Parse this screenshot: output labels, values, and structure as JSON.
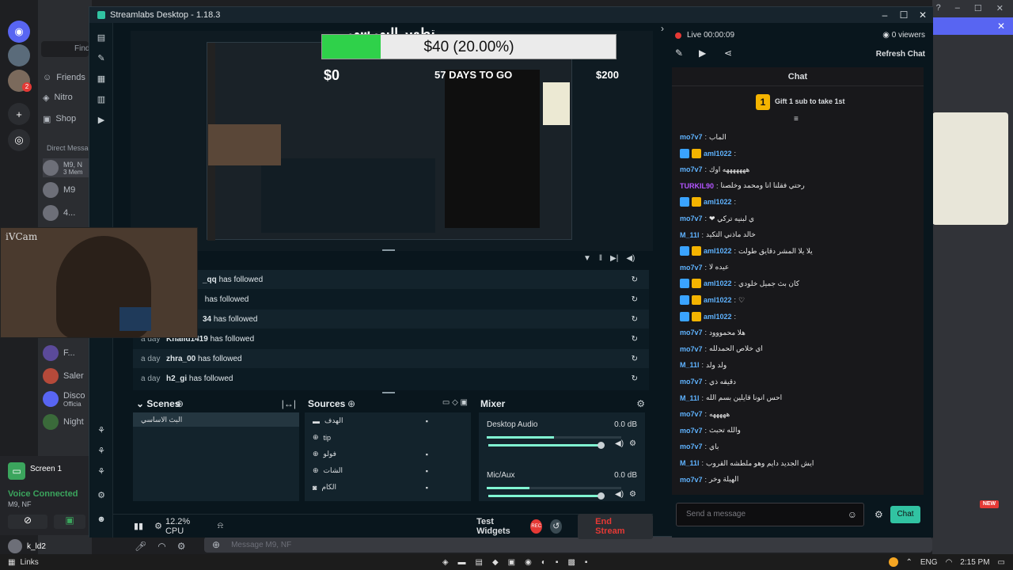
{
  "discord": {
    "find_label": "Find",
    "nav": [
      {
        "label": "Friends"
      },
      {
        "label": "Nitro"
      },
      {
        "label": "Shop"
      }
    ],
    "direct_messages_header": "Direct Messages",
    "dms": [
      {
        "name": "M9, N",
        "sub": "3 Mem"
      },
      {
        "name": "M9",
        "sub": ""
      },
      {
        "name": "4...",
        "sub": ""
      },
      {
        "name": "F...",
        "sub": ""
      },
      {
        "name": "Saler",
        "sub": ""
      },
      {
        "name": "Disco",
        "sub": "Officia"
      },
      {
        "name": "Night",
        "sub": ""
      }
    ],
    "screen_label": "Screen 1",
    "voice_connected": "Voice Connected",
    "voice_channel": "M9, NF",
    "username": "k_ld2",
    "message_placeholder": "Message M9, NF",
    "new_badge": "NEW",
    "mention_count": "2"
  },
  "webcam": {
    "label": "iVCam"
  },
  "streamlabs": {
    "title": "Streamlabs Desktop - 1.18.3",
    "overlay_title": "تطوير البي سي",
    "goal": {
      "text": "$40 (20.00%)",
      "progress": 0.2,
      "start": "$0",
      "days": "57 DAYS TO GO",
      "end": "$200"
    },
    "events": [
      {
        "time": "",
        "name": "_qq",
        "action": "has followed"
      },
      {
        "time": "",
        "name": "",
        "action": "has followed"
      },
      {
        "time": "",
        "name": "34",
        "action": "has followed"
      },
      {
        "time": "a day",
        "name": "Khalid1419",
        "action": "has followed"
      },
      {
        "time": "a day",
        "name": "zhra_00",
        "action": "has followed"
      },
      {
        "time": "a day",
        "name": "h2_gi",
        "action": "has followed"
      }
    ],
    "scenes": {
      "title": "Scenes",
      "items": [
        "البث الاساسي"
      ]
    },
    "sources": {
      "title": "Sources",
      "items": [
        "الهدف",
        "tip",
        "فولو",
        "الشات",
        "الكام"
      ]
    },
    "mixer": {
      "title": "Mixer",
      "channels": [
        {
          "name": "Desktop Audio",
          "db": "0.0 dB",
          "level": 0.95
        },
        {
          "name": "Mic/Aux",
          "db": "0.0 dB",
          "level": 0.95
        }
      ]
    },
    "footer": {
      "cpu": "12.2% CPU",
      "test_widgets": "Test Widgets",
      "end_stream": "End Stream"
    },
    "chat": {
      "live": "Live 00:00:09",
      "viewers": "0 viewers",
      "refresh": "Refresh Chat",
      "header": "Chat",
      "gift_rank": "1",
      "gift": "Gift 1 sub to take 1st",
      "placeholder": "Send a message",
      "send": "Chat",
      "messages": [
        {
          "user": "mo7v7",
          "msg": "الماب",
          "color": "#5fb3ff",
          "badges": false
        },
        {
          "user": "aml1022",
          "msg": "",
          "color": "#5fb3ff",
          "badges": true
        },
        {
          "user": "mo7v7",
          "msg": "هههههههه اوك",
          "color": "#5fb3ff",
          "badges": false
        },
        {
          "user": "TURKIL90",
          "msg": "رحتي فقلنا انا ومحمد وخلصنا",
          "color": "#b455ff",
          "badges": false
        },
        {
          "user": "aml1022",
          "msg": "",
          "color": "#5fb3ff",
          "badges": true
        },
        {
          "user": "mo7v7",
          "msg": "ي لبنيه تركي ❤",
          "color": "#5fb3ff",
          "badges": false
        },
        {
          "user": "M_11l",
          "msg": "خالد ماذني التكيد",
          "color": "#5fb3ff",
          "badges": false
        },
        {
          "user": "aml1022",
          "msg": "يلا يلا المشر دقايق طولت",
          "color": "#5fb3ff",
          "badges": true
        },
        {
          "user": "mo7v7",
          "msg": "عيده لا",
          "color": "#5fb3ff",
          "badges": false
        },
        {
          "user": "aml1022",
          "msg": "كان بث جميل خلودي",
          "color": "#5fb3ff",
          "badges": true
        },
        {
          "user": "aml1022",
          "msg": "♡",
          "color": "#5fb3ff",
          "badges": true
        },
        {
          "user": "aml1022",
          "msg": "",
          "color": "#5fb3ff",
          "badges": true
        },
        {
          "user": "mo7v7",
          "msg": "هلا محمووود",
          "color": "#5fb3ff",
          "badges": false
        },
        {
          "user": "mo7v7",
          "msg": "اي خلاص الحمدلله",
          "color": "#5fb3ff",
          "badges": false
        },
        {
          "user": "M_11l",
          "msg": "ولد ولد",
          "color": "#5fb3ff",
          "badges": false
        },
        {
          "user": "mo7v7",
          "msg": "دقيقه ذي",
          "color": "#5fb3ff",
          "badges": false
        },
        {
          "user": "M_11l",
          "msg": "احس انونا قايلين بسم الله",
          "color": "#5fb3ff",
          "badges": false
        },
        {
          "user": "mo7v7",
          "msg": "هههههه",
          "color": "#5fb3ff",
          "badges": false
        },
        {
          "user": "mo7v7",
          "msg": "والله تحبث",
          "color": "#5fb3ff",
          "badges": false
        },
        {
          "user": "mo7v7",
          "msg": "باي",
          "color": "#5fb3ff",
          "badges": false
        },
        {
          "user": "M_11l",
          "msg": "ايش الجديد دايم وهو ملطشه القروب",
          "color": "#5fb3ff",
          "badges": false
        },
        {
          "user": "mo7v7",
          "msg": "الهيلة وخر",
          "color": "#5fb3ff",
          "badges": false
        }
      ]
    }
  },
  "taskbar": {
    "links": "Links",
    "lang": "ENG",
    "time": "2:15 PM"
  },
  "colors": {
    "accent": "#80f5d2",
    "live": "#e53935",
    "chat_btn": "#31c3a2",
    "goal_fill": "#2fd14a",
    "discord_brand": "#5865f2"
  }
}
